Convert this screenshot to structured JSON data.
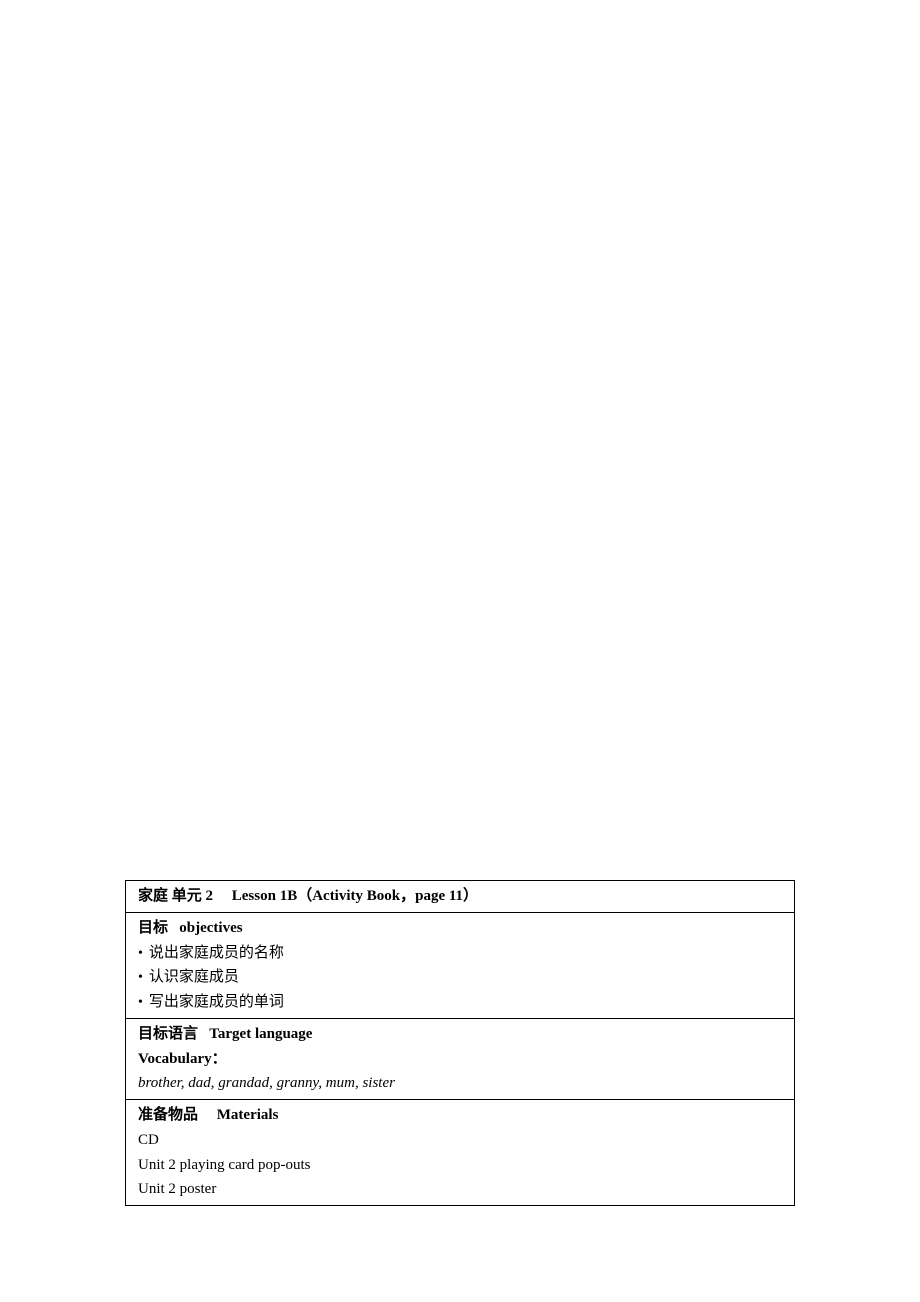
{
  "row1": {
    "unit_prefix": "家庭  单元 2",
    "lesson": "Lesson 1B（Activity Book，page 11）"
  },
  "row2": {
    "heading_cn": "目标",
    "heading_en": "objectives",
    "bullets": [
      "说出家庭成员的名称",
      "认识家庭成员",
      "写出家庭成员的单词"
    ]
  },
  "row3": {
    "heading_cn": "目标语言",
    "heading_en": "Target language",
    "vocab_label": "Vocabulary：",
    "vocab_list": "brother, dad, grandad, granny, mum, sister"
  },
  "row4": {
    "heading_cn": "准备物品",
    "heading_en": "Materials",
    "items": [
      "CD",
      "Unit 2 playing card pop-outs",
      "Unit 2 poster"
    ]
  }
}
